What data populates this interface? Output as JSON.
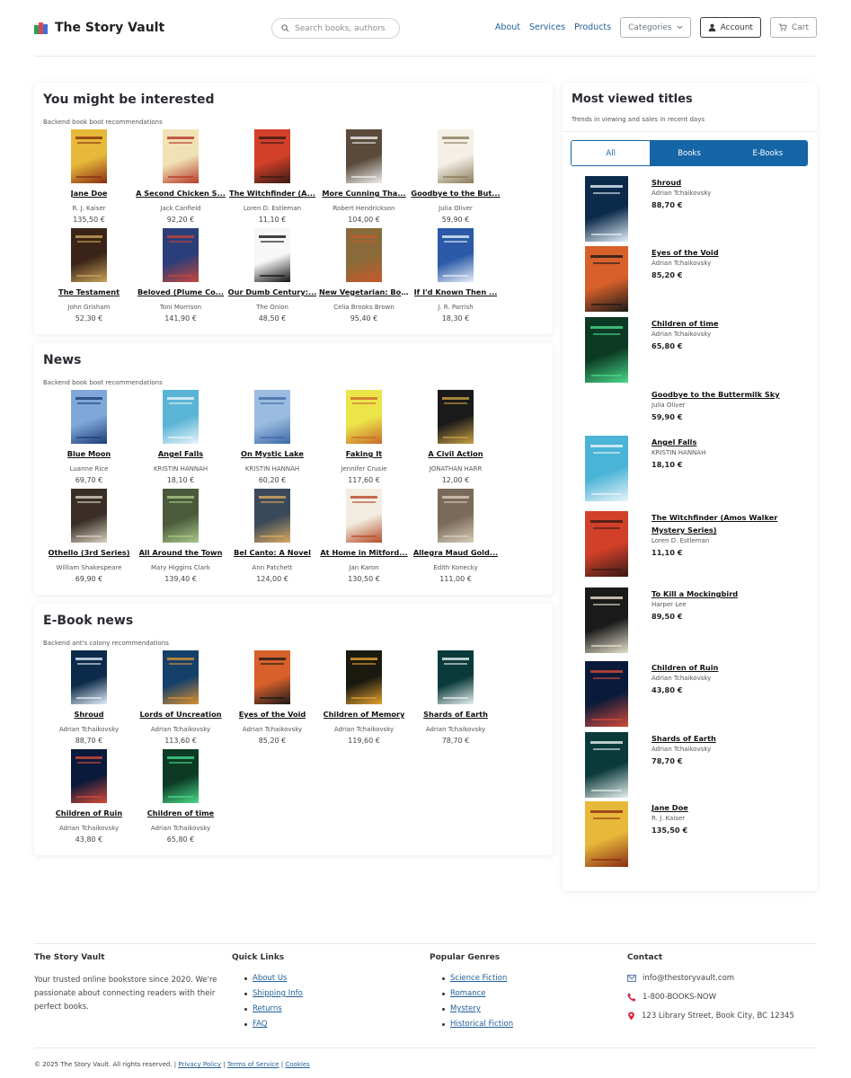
{
  "header": {
    "brand": "The Story Vault",
    "search_placeholder": "Search books, authors",
    "nav": [
      "About",
      "Services",
      "Products"
    ],
    "categories_label": "Categories",
    "account_label": "Account",
    "cart_label": "Cart"
  },
  "sections": [
    {
      "title": "You might be interested",
      "subtitle": "Backend book boot recommendations",
      "books": [
        {
          "title": "Jane Doe",
          "author": "R. J. Kaiser",
          "price": "135,50 €"
        },
        {
          "title": "A Second Chicken S...",
          "author": "Jack Canfield",
          "price": "92,20 €"
        },
        {
          "title": "The Witchfinder (A...",
          "author": "Loren D. Estleman",
          "price": "11,10 €"
        },
        {
          "title": "More Cunning Tha...",
          "author": "Robert Hendrickson",
          "price": "104,00 €"
        },
        {
          "title": "Goodbye to the But...",
          "author": "Julia Oliver",
          "price": "59,90 €"
        },
        {
          "title": "The Testament",
          "author": "John Grisham",
          "price": "52,30 €"
        },
        {
          "title": "Beloved (Plume Co...",
          "author": "Toni Morrison",
          "price": "141,90 €"
        },
        {
          "title": "Our Dumb Century:...",
          "author": "The Onion",
          "price": "48,50 €"
        },
        {
          "title": "New Vegetarian: Bo...",
          "author": "Celia Brooks Brown",
          "price": "95,40 €"
        },
        {
          "title": "If I'd Known Then ...",
          "author": "J. R. Parrish",
          "price": "18,30 €"
        }
      ]
    },
    {
      "title": "News",
      "subtitle": "Backend book boot recommendations",
      "books": [
        {
          "title": "Blue Moon",
          "author": "Luanne Rice",
          "price": "69,70 €"
        },
        {
          "title": "Angel Falls",
          "author": "KRISTIN HANNAH",
          "price": "18,10 €"
        },
        {
          "title": "On Mystic Lake",
          "author": "KRISTIN HANNAH",
          "price": "60,20 €"
        },
        {
          "title": "Faking It",
          "author": "Jennifer Crusie",
          "price": "117,60 €"
        },
        {
          "title": "A Civil Action",
          "author": "JONATHAN HARR",
          "price": "12,00 €"
        },
        {
          "title": "Othello (3rd Series)",
          "author": "William Shakespeare",
          "price": "69,90 €"
        },
        {
          "title": "All Around the Town",
          "author": "Mary Higgins Clark",
          "price": "139,40 €"
        },
        {
          "title": "Bel Canto: A Novel",
          "author": "Ann Patchett",
          "price": "124,00 €"
        },
        {
          "title": "At Home in Mitford...",
          "author": "Jan Karon",
          "price": "130,50 €"
        },
        {
          "title": "Allegra Maud Gold...",
          "author": "Edith Konecky",
          "price": "111,00 €"
        }
      ]
    },
    {
      "title": "E-Book news",
      "subtitle": "Backend ant's colony recommendations",
      "books": [
        {
          "title": "Shroud",
          "author": "Adrian Tchaikovsky",
          "price": "88,70 €"
        },
        {
          "title": "Lords of Uncreation",
          "author": "Adrian Tchaikovsky",
          "price": "113,60 €"
        },
        {
          "title": "Eyes of the Void",
          "author": "Adrian Tchaikovsky",
          "price": "85,20 €"
        },
        {
          "title": "Children of Memory",
          "author": "Adrian Tchaikovsky",
          "price": "119,60 €"
        },
        {
          "title": "Shards of Earth",
          "author": "Adrian Tchaikovsky",
          "price": "78,70 €"
        },
        {
          "title": "Children of Ruin",
          "author": "Adrian Tchaikovsky",
          "price": "43,80 €"
        },
        {
          "title": "Children of time",
          "author": "Adrian Tchaikovsky",
          "price": "65,80 €"
        }
      ]
    }
  ],
  "most_viewed": {
    "title": "Most viewed titles",
    "subtitle": "Trends in viewing and sales in recent days",
    "tabs": [
      "All",
      "Books",
      "E-Books"
    ],
    "items": [
      {
        "title": "Shroud",
        "author": "Adrian Tchaikovsky",
        "price": "88,70 €"
      },
      {
        "title": "Eyes of the Void",
        "author": "Adrian Tchaikovsky",
        "price": "85,20 €"
      },
      {
        "title": "Children of time",
        "author": "Adrian Tchaikovsky",
        "price": "65,80 €"
      },
      {
        "title": "Goodbye to the Buttermilk Sky",
        "author": "Julia Oliver",
        "price": "59,90 €"
      },
      {
        "title": "Angel Falls",
        "author": "KRISTIN HANNAH",
        "price": "18,10 €"
      },
      {
        "title": "The Witchfinder (Amos Walker Mystery Series)",
        "author": "Loren D. Estleman",
        "price": "11,10 €"
      },
      {
        "title": "To Kill a Mockingbird",
        "author": "Harper Lee",
        "price": "89,50 €"
      },
      {
        "title": "Children of Ruin",
        "author": "Adrian Tchaikovsky",
        "price": "43,80 €"
      },
      {
        "title": "Shards of Earth",
        "author": "Adrian Tchaikovsky",
        "price": "78,70 €"
      },
      {
        "title": "Jane Doe",
        "author": "R. J. Kaiser",
        "price": "135,50 €"
      }
    ]
  },
  "footer": {
    "about_title": "The Story Vault",
    "about_text": "Your trusted online bookstore since 2020. We're passionate about connecting readers with their perfect books.",
    "quick_title": "Quick Links",
    "quick_links": [
      "About Us",
      "Shipping Info",
      "Returns",
      "FAQ"
    ],
    "genres_title": "Popular Genres",
    "genres": [
      "Science Fiction",
      "Romance",
      "Mystery",
      "Historical Fiction"
    ],
    "contact_title": "Contact",
    "email": "info@thestoryvault.com",
    "phone": "1-800-BOOKS-NOW",
    "address": "123 Library Street, Book City, BC 12345",
    "copyright": "© 2025 The Story Vault. All rights reserved.",
    "legal": [
      "Privacy Policy",
      "Terms of Service",
      "Cookies"
    ]
  },
  "colors": {
    "primary": "#1565a7",
    "link": "#1f5f99",
    "text": "#212529"
  }
}
